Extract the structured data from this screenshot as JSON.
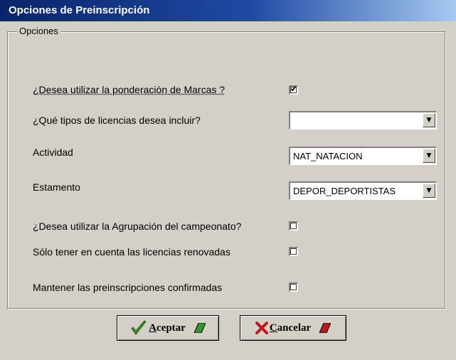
{
  "window": {
    "title": "Opciones de Preinscripción"
  },
  "group": {
    "caption": "Opciones"
  },
  "options": {
    "ponderacion_label": "¿Desea utilizar la ponderación de Marcas ?",
    "ponderacion_checked": true,
    "licencias_label": "¿Qué tipos de licencias desea incluir?",
    "licencias_value": "",
    "actividad_label": "Actividad",
    "actividad_value": "NAT_NATACION",
    "estamento_label": "Estamento",
    "estamento_value": "DEPOR_DEPORTISTAS",
    "agrupacion_label": "¿Desea utilizar la Agrupación del campeonato?",
    "agrupacion_checked": false,
    "renovadas_label": "Sólo tener en cuenta las licencias renovadas",
    "renovadas_checked": false,
    "mantener_label": "Mantener las preinscripciones confirmadas",
    "mantener_checked": false
  },
  "buttons": {
    "accept_first": "A",
    "accept_rest": "ceptar",
    "cancel_first": "C",
    "cancel_rest": "ancelar"
  },
  "colors": {
    "titlebar_start": "#0a246a",
    "titlebar_end": "#a6caf0",
    "accept_check": "#3c9a2a",
    "accept_slash": "#2e9a2e",
    "cancel_x": "#c0161c",
    "cancel_slash": "#c0161c"
  },
  "icons": {
    "accept": "checkmark-icon",
    "cancel": "x-icon",
    "dropdown": "triangle-down-icon"
  }
}
